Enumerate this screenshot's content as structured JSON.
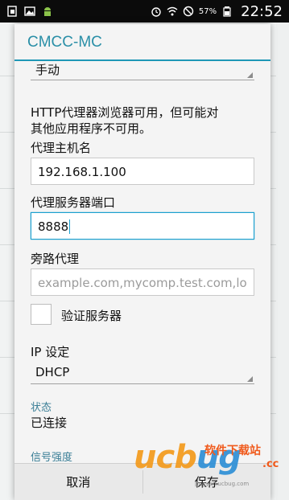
{
  "status_bar": {
    "battery_percent": "57%",
    "time": "22:52",
    "left_icons": [
      "sim-card-icon",
      "image-icon",
      "android-icon"
    ],
    "right_icons": [
      "alarm-icon",
      "wifi-icon",
      "no-signal-icon",
      "battery-icon"
    ]
  },
  "dialog": {
    "title": "CMCC-MC",
    "proxy_mode_value": "手动",
    "info_text_line1": "HTTP代理器浏览器可用，但可能对",
    "info_text_line2": "其他应用程序不可用。",
    "hostname_label": "代理主机名",
    "hostname_value": "192.168.1.100",
    "port_label": "代理服务器端口",
    "port_value": "8888",
    "bypass_label": "旁路代理",
    "bypass_placeholder": "example.com,mycomp.test.com,lo",
    "verify_server_label": "验证服务器",
    "verify_server_checked": false,
    "ip_settings_label": "IP 设定",
    "ip_settings_value": "DHCP",
    "status_label": "状态",
    "status_value": "已连接",
    "signal_label": "信号强度",
    "cancel_label": "取消",
    "save_label": "保存"
  },
  "watermark": {
    "logo_text_a": "ucb",
    "logo_text_b": "ug",
    "site_cn": "软件下载站",
    "domain_suffix": ".cc",
    "site_url": "pngyan.ucbug.com"
  },
  "colors": {
    "accent": "#1f97b6",
    "title": "#2a8fa7",
    "section_label": "#3a7e96",
    "watermark_orange": "#f39a1c"
  }
}
